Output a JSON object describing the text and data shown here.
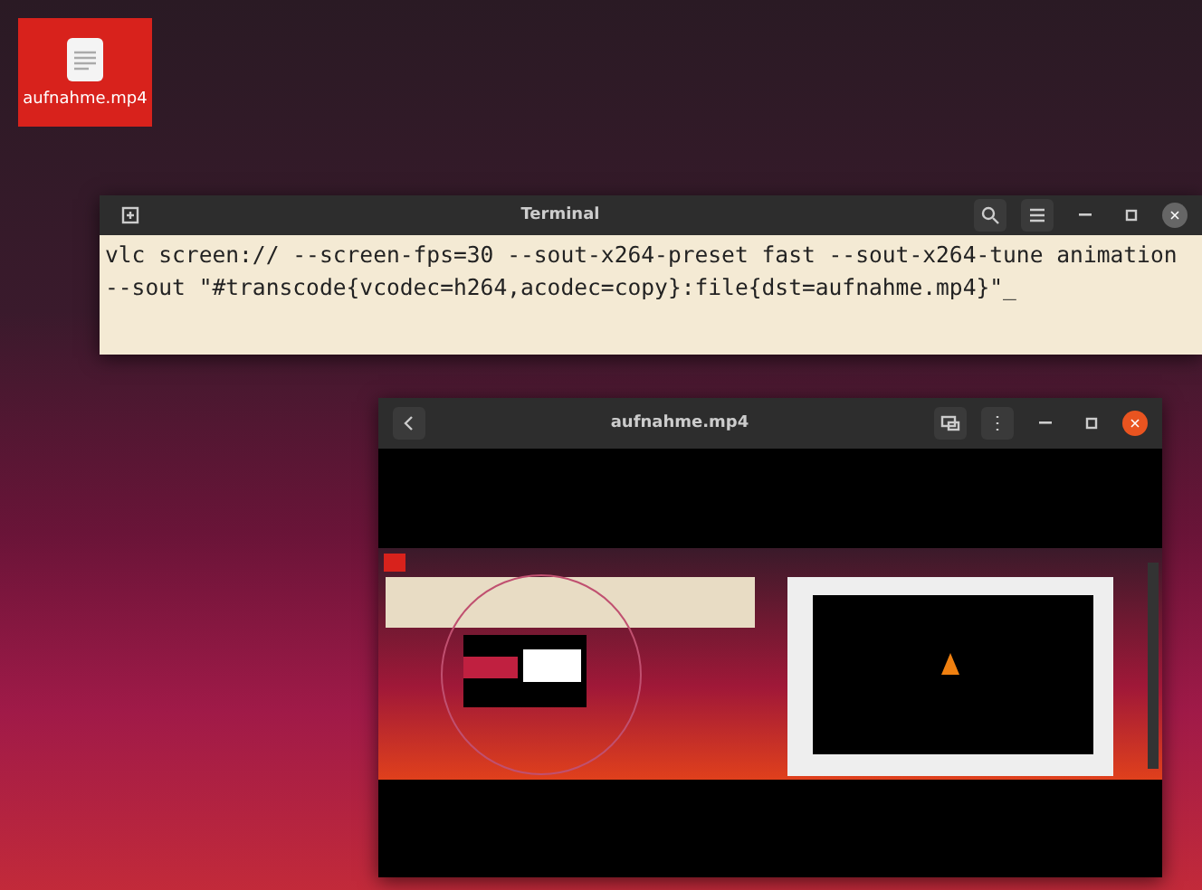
{
  "desktop_icons": [
    {
      "label": "aufnahme.mp4",
      "selected": true
    }
  ],
  "terminal": {
    "title": "Terminal",
    "lines": [
      "vlc screen:// --screen-fps=30 --sout-x264-preset fast --sout-x264-tune animation",
      "--sout \"#transcode{vcodec=h264,acodec=copy}:file{dst=aufnahme.mp4}\""
    ],
    "cursor": "_"
  },
  "player": {
    "title": "aufnahme.mp4"
  }
}
